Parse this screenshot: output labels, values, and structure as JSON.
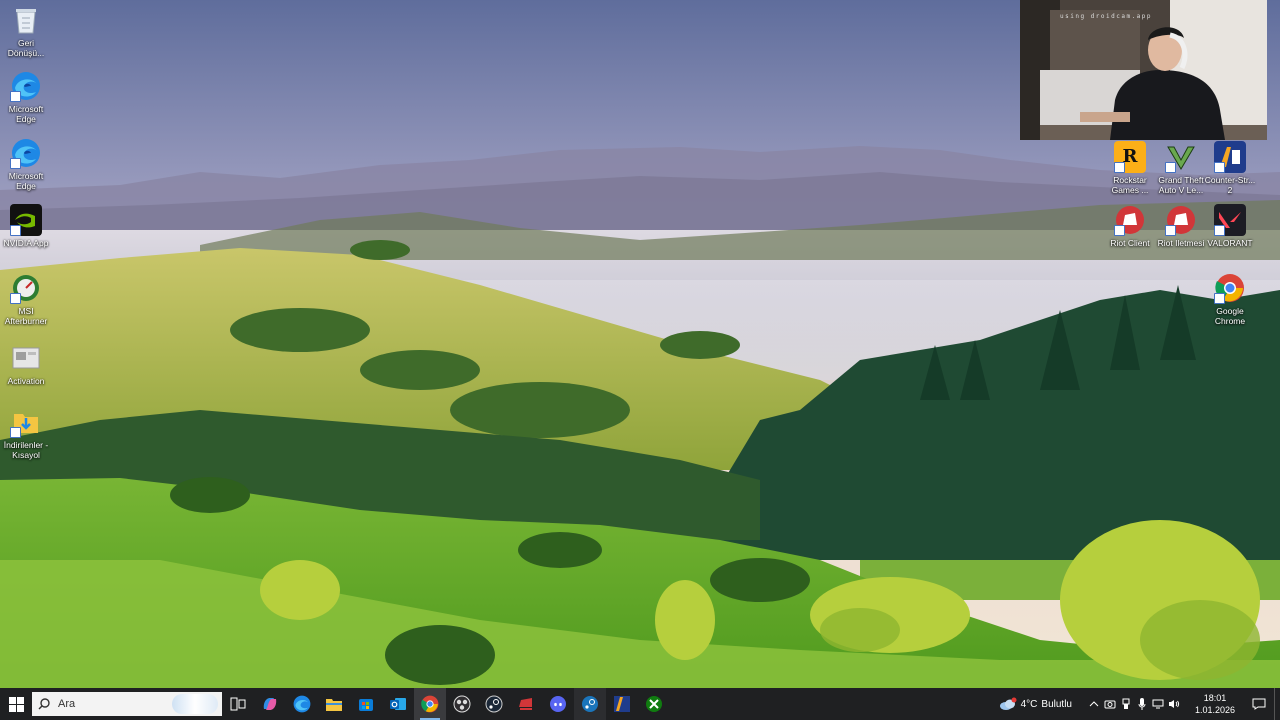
{
  "desktop_left": [
    {
      "name": "recycle-bin",
      "label": "Geri Dönüşü...",
      "icon": "recycle-bin-icon"
    },
    {
      "name": "edge-1",
      "label": "Microsoft Edge",
      "icon": "edge-icon"
    },
    {
      "name": "edge-2",
      "label": "Microsoft Edge",
      "icon": "edge-icon"
    },
    {
      "name": "nvidia",
      "label": "NVIDIA App",
      "icon": "nvidia-icon"
    },
    {
      "name": "afterburner",
      "label": "MSI Afterburner",
      "icon": "msi-afterburner-icon"
    },
    {
      "name": "activation",
      "label": "Activation",
      "icon": "activation-icon"
    },
    {
      "name": "downloads",
      "label": "İndirilenler - Kısayol",
      "icon": "downloads-folder-icon"
    }
  ],
  "desktop_right": [
    {
      "name": "rockstar",
      "label": "Rockstar Games ...",
      "icon": "rockstar-icon"
    },
    {
      "name": "gta",
      "label": "Grand Theft Auto V Le...",
      "icon": "gta-v-icon"
    },
    {
      "name": "cs2",
      "label": "Counter-Str... 2",
      "icon": "counter-strike-icon"
    },
    {
      "name": "riot",
      "label": "Riot Client",
      "icon": "riot-client-icon"
    },
    {
      "name": "riot-err",
      "label": "Riot Iletmesi",
      "icon": "riot-client-icon"
    },
    {
      "name": "valorant",
      "label": "VALORANT",
      "icon": "valorant-icon"
    },
    {
      "name": "chrome",
      "label": "Google Chrome",
      "icon": "chrome-icon"
    }
  ],
  "webcam": {
    "caption": "using droidcam.app"
  },
  "taskbar": {
    "search_placeholder": "Ara",
    "apps": [
      {
        "name": "task-view",
        "icon": "task-view-icon"
      },
      {
        "name": "copilot",
        "icon": "copilot-icon"
      },
      {
        "name": "edge",
        "icon": "edge-icon"
      },
      {
        "name": "file-explorer",
        "icon": "folder-icon"
      },
      {
        "name": "store",
        "icon": "store-icon"
      },
      {
        "name": "outlook",
        "icon": "outlook-icon"
      },
      {
        "name": "chrome",
        "icon": "chrome-icon",
        "active": true
      },
      {
        "name": "obs",
        "icon": "obs-icon"
      },
      {
        "name": "steam-dark",
        "icon": "steam-icon"
      },
      {
        "name": "riot",
        "icon": "riot-icon"
      },
      {
        "name": "discord",
        "icon": "discord-icon"
      },
      {
        "name": "steam",
        "icon": "steam-icon"
      },
      {
        "name": "cs2",
        "icon": "counter-strike-icon"
      },
      {
        "name": "xbox",
        "icon": "xbox-icon"
      }
    ],
    "weather": {
      "temp": "4°C",
      "condition": "Bulutlu"
    },
    "clock": {
      "time": "18:01",
      "date": "1.01.2026"
    }
  }
}
